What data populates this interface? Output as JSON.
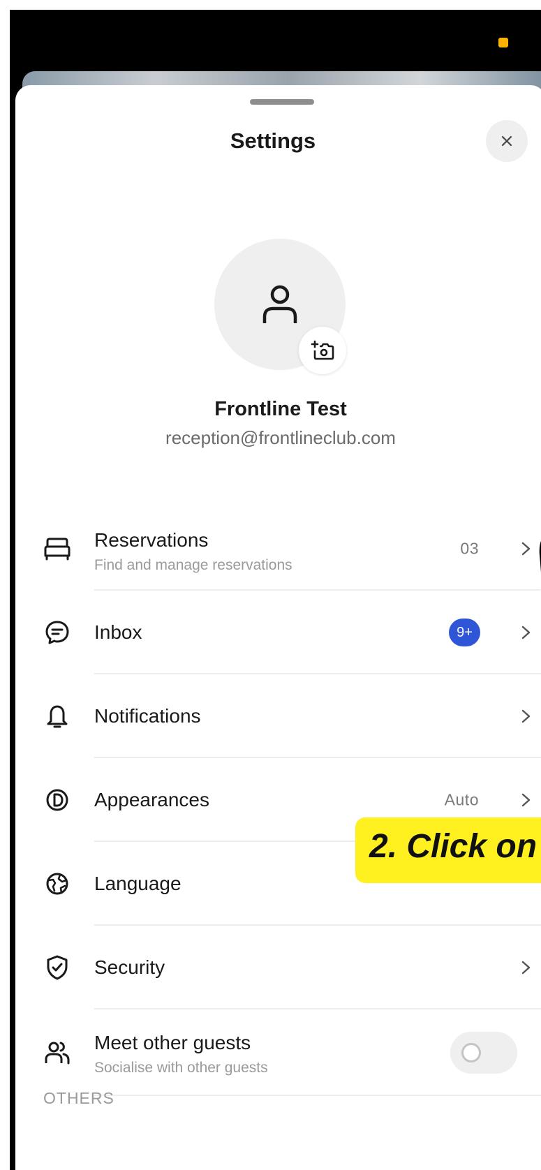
{
  "header": {
    "title": "Settings",
    "close_label": "×"
  },
  "profile": {
    "name": "Frontline Test",
    "email": "reception@frontlineclub.com"
  },
  "menu": {
    "items": [
      {
        "icon": "bed-icon",
        "label": "Reservations",
        "sublabel": "Find and manage reservations",
        "value": "03"
      },
      {
        "icon": "chat-bubble-icon",
        "label": "Inbox",
        "badge": "9+"
      },
      {
        "icon": "bell-icon",
        "label": "Notifications"
      },
      {
        "icon": "appearance-icon",
        "label": "Appearances",
        "value": "Auto"
      },
      {
        "icon": "globe-icon",
        "label": "Language"
      },
      {
        "icon": "shield-icon",
        "label": "Security"
      },
      {
        "icon": "people-icon",
        "label": "Meet other guests",
        "sublabel": "Socialise with other guests",
        "toggle_on": false
      }
    ]
  },
  "section_others": "OTHERS",
  "annotation": {
    "text": "2. Click on",
    "highlight_color": "#fff01f"
  },
  "colors": {
    "badge": "#2f56d6",
    "status_dot": "#ffb300"
  }
}
